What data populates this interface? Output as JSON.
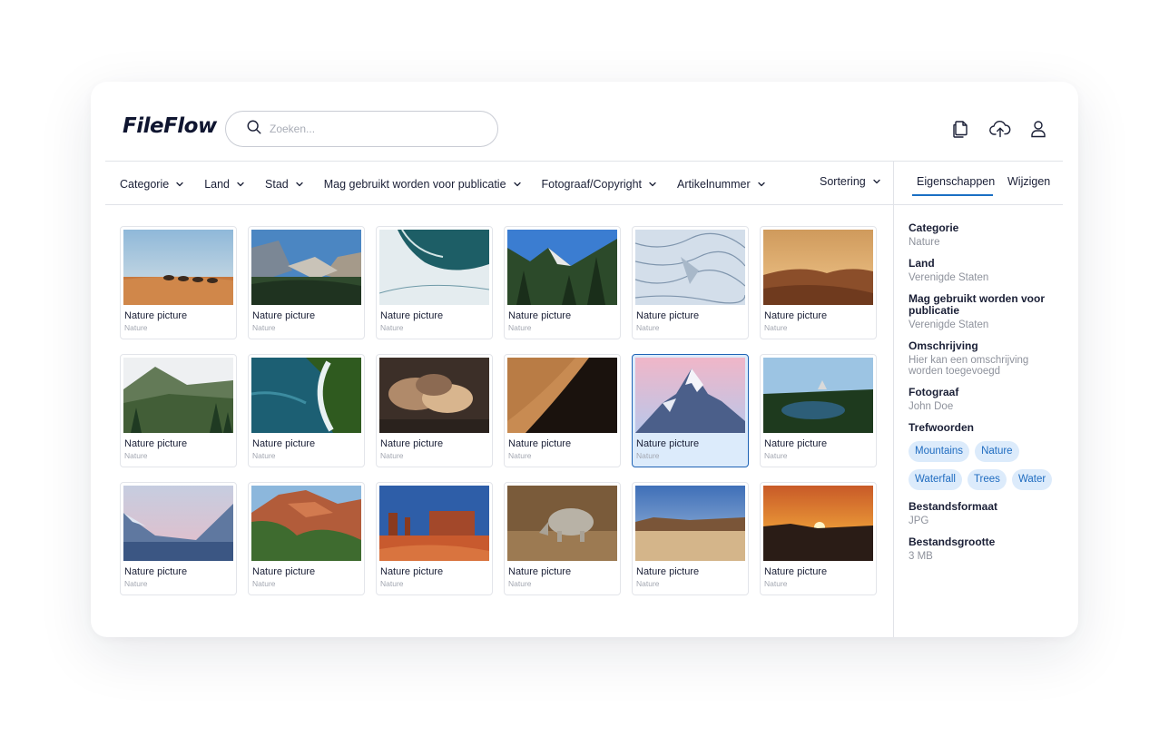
{
  "app": {
    "logo": "FileFlow"
  },
  "search": {
    "placeholder": "Zoeken..."
  },
  "header_icons": [
    "documents-icon",
    "cloud-upload-icon",
    "user-icon"
  ],
  "filters": [
    {
      "label": "Categorie"
    },
    {
      "label": "Land"
    },
    {
      "label": "Stad"
    },
    {
      "label": "Mag gebruikt worden voor publicatie"
    },
    {
      "label": "Fotograaf/Copyright"
    },
    {
      "label": "Artikelnummer"
    }
  ],
  "sort": {
    "label": "Sortering"
  },
  "panel_tabs": {
    "properties": "Eigenschappen",
    "edit": "Wijzigen",
    "active": "Eigenschappen"
  },
  "images": [
    {
      "title": "Nature picture",
      "category": "Nature",
      "scene": "desert-camels"
    },
    {
      "title": "Nature picture",
      "category": "Nature",
      "scene": "yosemite-valley"
    },
    {
      "title": "Nature picture",
      "category": "Nature",
      "scene": "ice-lake-aerial"
    },
    {
      "title": "Nature picture",
      "category": "Nature",
      "scene": "pine-forest"
    },
    {
      "title": "Nature picture",
      "category": "Nature",
      "scene": "glacier"
    },
    {
      "title": "Nature picture",
      "category": "Nature",
      "scene": "desert-dunes-sunset"
    },
    {
      "title": "Nature picture",
      "category": "Nature",
      "scene": "green-mountain-valley"
    },
    {
      "title": "Nature picture",
      "category": "Nature",
      "scene": "coast-waves-aerial"
    },
    {
      "title": "Nature picture",
      "category": "Nature",
      "scene": "clouds"
    },
    {
      "title": "Nature picture",
      "category": "Nature",
      "scene": "sand-dune-ridge"
    },
    {
      "title": "Nature picture",
      "category": "Nature",
      "scene": "snowy-peak-pink-sky",
      "selected": true
    },
    {
      "title": "Nature picture",
      "category": "Nature",
      "scene": "forest-lake"
    },
    {
      "title": "Nature picture",
      "category": "Nature",
      "scene": "snowy-mountains-lake"
    },
    {
      "title": "Nature picture",
      "category": "Nature",
      "scene": "zion-canyon"
    },
    {
      "title": "Nature picture",
      "category": "Nature",
      "scene": "monument-valley"
    },
    {
      "title": "Nature picture",
      "category": "Nature",
      "scene": "rhino"
    },
    {
      "title": "Nature picture",
      "category": "Nature",
      "scene": "desert-plateau"
    },
    {
      "title": "Nature picture",
      "category": "Nature",
      "scene": "sunset-horizon"
    }
  ],
  "properties": {
    "category": {
      "label": "Categorie",
      "value": "Nature"
    },
    "country": {
      "label": "Land",
      "value": "Verenigde Staten"
    },
    "publication": {
      "label": "Mag gebruikt worden voor publicatie",
      "value": "Verenigde Staten"
    },
    "description": {
      "label": "Omschrijving",
      "value": "Hier kan een omschrijving worden toegevoegd"
    },
    "photographer": {
      "label": "Fotograaf",
      "value": "John Doe"
    },
    "keywords": {
      "label": "Trefwoorden",
      "tags": [
        "Mountains",
        "Nature",
        "Waterfall",
        "Trees",
        "Water"
      ]
    },
    "file_format": {
      "label": "Bestandsformaat",
      "value": "JPG"
    },
    "file_size": {
      "label": "Bestandsgrootte",
      "value": "3 MB"
    }
  },
  "colors": {
    "accent": "#1a6fc4",
    "tag_bg": "#dcebfb",
    "tag_text": "#1f6cc0",
    "selected_border": "#1f63b5"
  }
}
